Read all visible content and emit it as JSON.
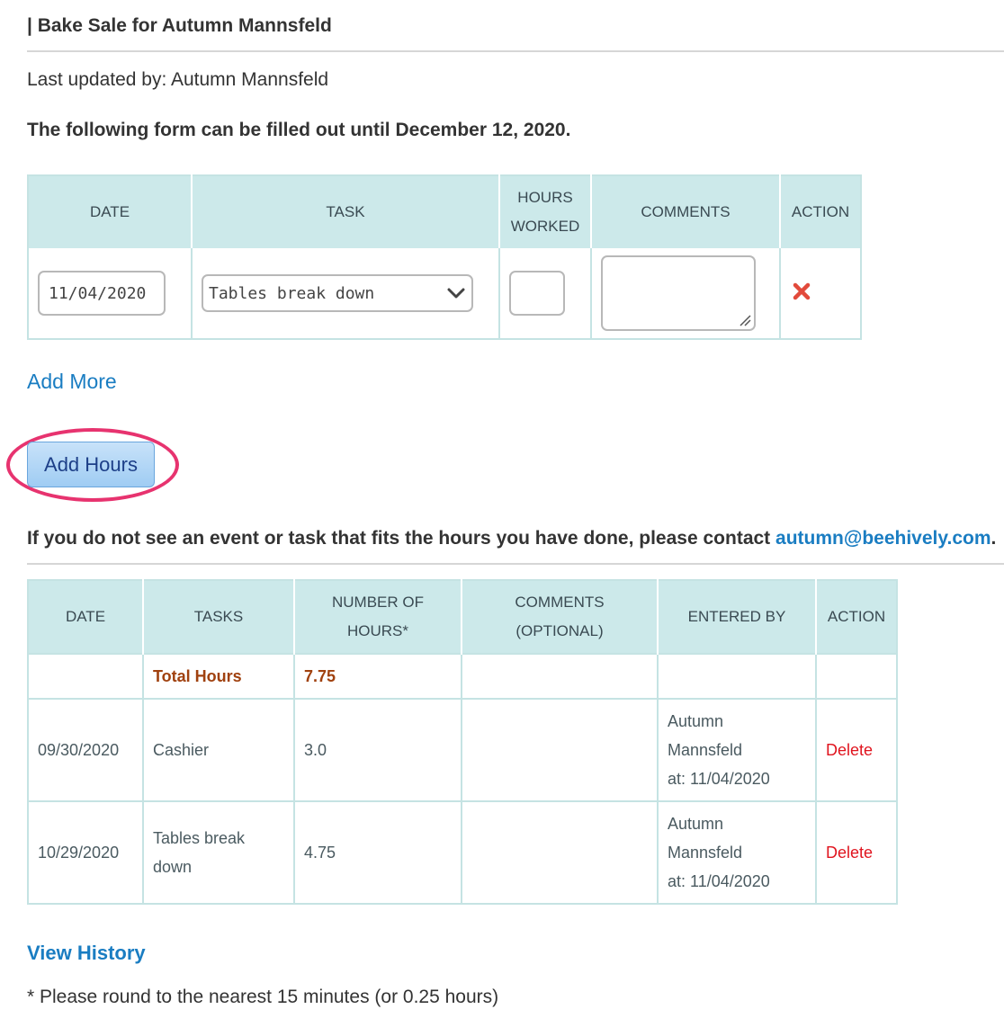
{
  "header": {
    "title": "| Bake Sale for Autumn Mannsfeld",
    "last_updated": "Last updated by: Autumn Mannsfeld",
    "deadline": "The following form can be filled out until December 12, 2020."
  },
  "entry_form": {
    "columns": [
      "DATE",
      "TASK",
      "HOURS\nWORKED",
      "COMMENTS",
      "ACTION"
    ],
    "date_value": "11/04/2020",
    "task_selected": "Tables break down",
    "hours_value": "",
    "comments_value": "",
    "remove_icon": "red-x-icon"
  },
  "links": {
    "add_more": "Add More",
    "view_history": "View History"
  },
  "buttons": {
    "add_hours": "Add Hours"
  },
  "contact": {
    "text": "If you do not see an event or task that fits the hours you have done, please contact ",
    "email": "autumn@beehively.com",
    "suffix": "."
  },
  "history": {
    "columns": [
      "DATE",
      "TASKS",
      "NUMBER OF\nHOURS*",
      "COMMENTS\n(OPTIONAL)",
      "ENTERED BY",
      "ACTION"
    ],
    "total_label": "Total Hours",
    "total_value": "7.75",
    "rows": [
      {
        "date": "09/30/2020",
        "task": "Cashier",
        "hours": "3.0",
        "comments": "",
        "entered_by_name": "Autumn\nMannsfeld",
        "entered_at": "at: 11/04/2020",
        "action": "Delete"
      },
      {
        "date": "10/29/2020",
        "task": "Tables break\ndown",
        "hours": "4.75",
        "comments": "",
        "entered_by_name": "Autumn\nMannsfeld",
        "entered_at": "at: 11/04/2020",
        "action": "Delete"
      }
    ]
  },
  "footnote": "* Please round to the nearest 15 minutes (or 0.25 hours)",
  "colors": {
    "header_bg": "#cce9ea",
    "link": "#1a7dc2",
    "total": "#a0410f",
    "delete": "#e0141e",
    "highlight": "#e7336f"
  }
}
